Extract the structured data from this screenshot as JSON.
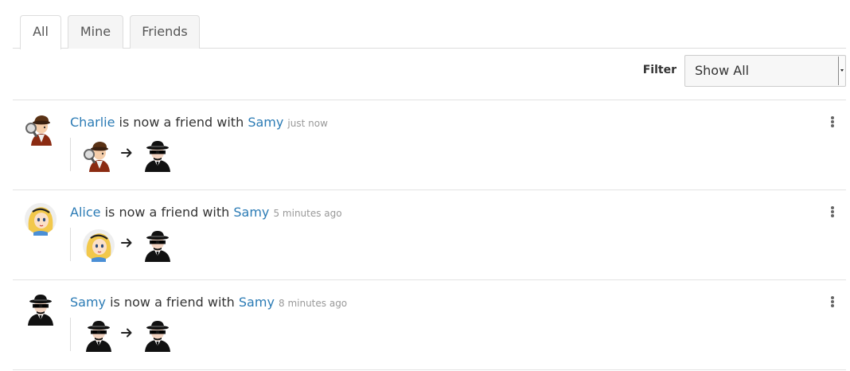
{
  "tabs": [
    {
      "label": "All",
      "active": true
    },
    {
      "label": "Mine",
      "active": false
    },
    {
      "label": "Friends",
      "active": false
    }
  ],
  "filter": {
    "label": "Filter",
    "selected": "Show All"
  },
  "feed": [
    {
      "actor": "Charlie",
      "action": "is now a friend with",
      "target": "Samy",
      "time": "just now",
      "actor_avatar": "detective-avatar-icon",
      "target_avatar": "spy-avatar-icon"
    },
    {
      "actor": "Alice",
      "action": "is now a friend with",
      "target": "Samy",
      "time": "5 minutes ago",
      "actor_avatar": "alice-avatar-icon",
      "target_avatar": "spy-avatar-icon"
    },
    {
      "actor": "Samy",
      "action": "is now a friend with",
      "target": "Samy",
      "time": "8 minutes ago",
      "actor_avatar": "spy-avatar-icon",
      "target_avatar": "spy-avatar-icon"
    }
  ],
  "colors": {
    "link": "#2b7bb5",
    "time": "#999999",
    "divider": "#e3e3e3"
  }
}
